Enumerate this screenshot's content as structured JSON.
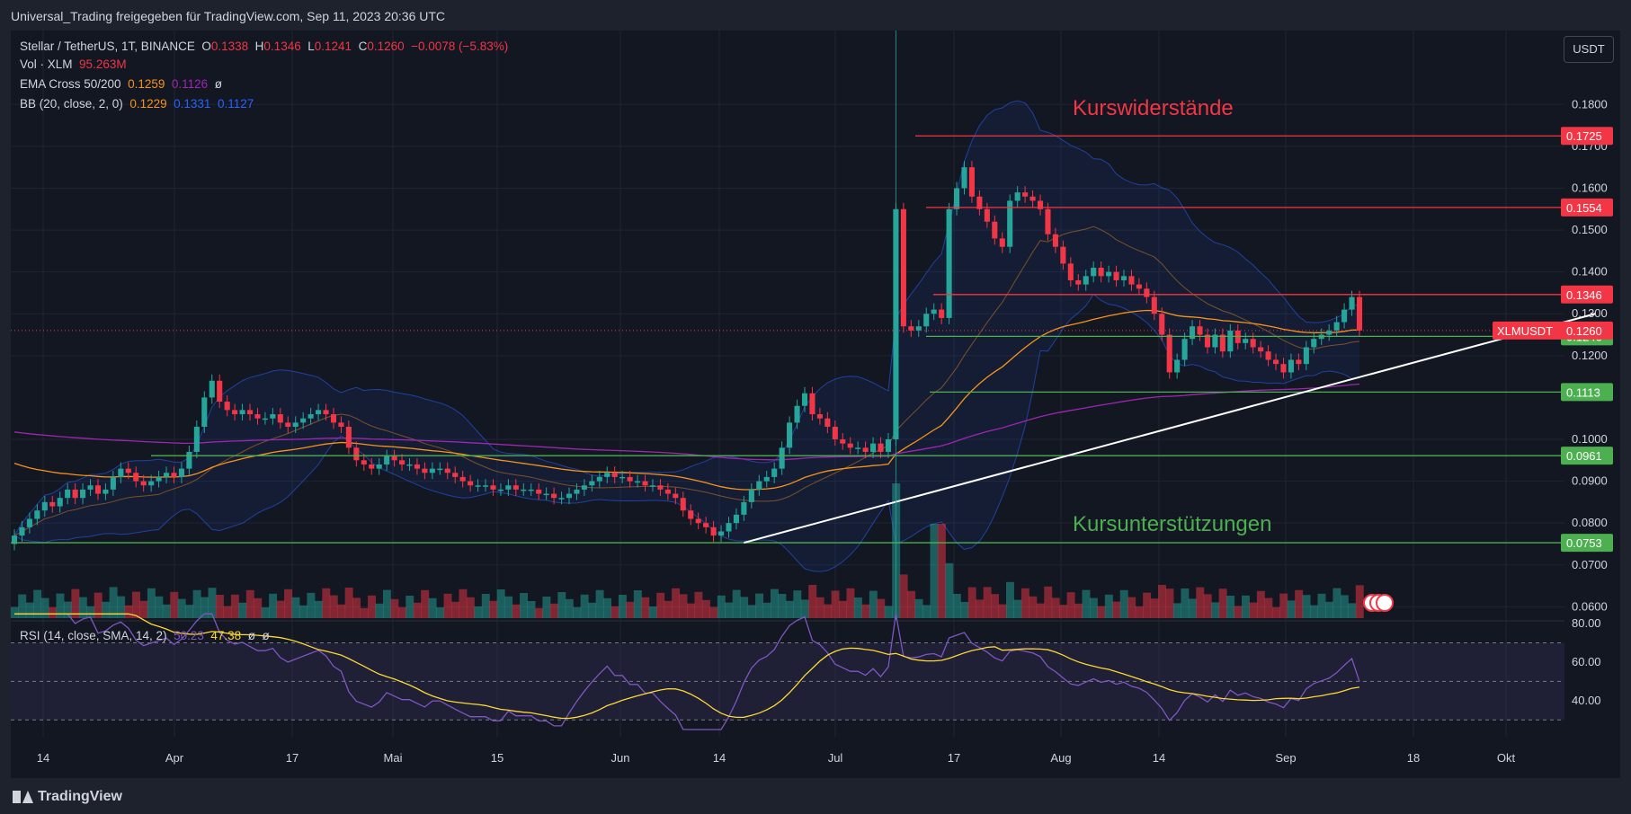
{
  "header": {
    "text": "Universal_Trading freigegeben für TradingView.com, Sep 11, 2023 20:36 UTC"
  },
  "footer": {
    "brand": "TradingView"
  },
  "currency_button": "USDT",
  "legend": {
    "symbol": "Stellar / TetherUS, 1T, BINANCE",
    "o_label": "O",
    "o": "0.1338",
    "h_label": "H",
    "h": "0.1346",
    "l_label": "L",
    "l": "0.1241",
    "c_label": "C",
    "c": "0.1260",
    "change": "−0.0078 (−5.83%)",
    "vol_label": "Vol · XLM",
    "vol": "95.263M",
    "ema_label": "EMA Cross 50/200",
    "ema50": "0.1259",
    "ema200": "0.1126",
    "ema_sym": "ø",
    "bb_label": "BB (20, close, 2, 0)",
    "bb_mid": "0.1229",
    "bb_up": "0.1331",
    "bb_low": "0.1127",
    "rsi_label": "RSI (14, close, SMA, 14, 2)",
    "rsi": "50.23",
    "rsi_ma": "47.38",
    "rsi_sym1": "ø",
    "rsi_sym2": "ø"
  },
  "annotations": {
    "resistance": "Kurswiderstände",
    "support": "Kursunterstützungen"
  },
  "colors": {
    "bg": "#131722",
    "up": "#26a69a",
    "down": "#f23645",
    "resistance": "#f23645",
    "support": "#4caf50",
    "ema50": "#f7931a",
    "ema200": "#9c27b0",
    "bb": "#2962ff",
    "rsi": "#7e57c2",
    "rsi_ma": "#fdd835",
    "trend": "#ffffff"
  },
  "chart_data": {
    "type": "candlestick",
    "y_ticks": [
      "0.1800",
      "0.1700",
      "0.1600",
      "0.1500",
      "0.1400",
      "0.1300",
      "0.1200",
      "0.1000",
      "0.0900",
      "0.0800",
      "0.0700",
      "0.0600"
    ],
    "x_ticks": [
      "14",
      "Apr",
      "17",
      "Mai",
      "15",
      "Jun",
      "14",
      "Jul",
      "17",
      "Aug",
      "14",
      "Sep",
      "18",
      "Okt"
    ],
    "ylim": [
      0.059,
      0.1835
    ],
    "rsi_ticks": [
      "80.00",
      "60.00",
      "40.00"
    ],
    "resistance_levels": [
      {
        "value": 0.1725,
        "label": "0.1725"
      },
      {
        "value": 0.1554,
        "label": "0.1554"
      },
      {
        "value": 0.1346,
        "label": "0.1346"
      }
    ],
    "support_levels": [
      {
        "value": 0.1246,
        "label": "0.1246"
      },
      {
        "value": 0.1113,
        "label": "0.1113"
      },
      {
        "value": 0.0961,
        "label": "0.0961"
      },
      {
        "value": 0.0753,
        "label": "0.0753"
      }
    ],
    "last_price": {
      "label": "XLMUSDT",
      "value": "0.1260"
    },
    "trendline": {
      "from": {
        "date": "2023-06-15",
        "price": 0.0753
      },
      "to": {
        "date": "2023-10-05",
        "price": 0.13
      }
    },
    "closes": [
      0.077,
      0.079,
      0.081,
      0.083,
      0.085,
      0.084,
      0.086,
      0.088,
      0.086,
      0.088,
      0.089,
      0.087,
      0.088,
      0.091,
      0.093,
      0.092,
      0.09,
      0.089,
      0.09,
      0.091,
      0.092,
      0.091,
      0.093,
      0.097,
      0.103,
      0.11,
      0.114,
      0.109,
      0.107,
      0.106,
      0.107,
      0.106,
      0.105,
      0.105,
      0.106,
      0.104,
      0.103,
      0.104,
      0.105,
      0.106,
      0.107,
      0.106,
      0.104,
      0.103,
      0.098,
      0.095,
      0.094,
      0.093,
      0.094,
      0.096,
      0.095,
      0.094,
      0.094,
      0.093,
      0.092,
      0.093,
      0.093,
      0.092,
      0.091,
      0.09,
      0.089,
      0.089,
      0.089,
      0.088,
      0.088,
      0.089,
      0.088,
      0.088,
      0.088,
      0.087,
      0.087,
      0.086,
      0.086,
      0.087,
      0.088,
      0.089,
      0.09,
      0.091,
      0.092,
      0.091,
      0.091,
      0.09,
      0.09,
      0.089,
      0.089,
      0.088,
      0.087,
      0.086,
      0.083,
      0.081,
      0.08,
      0.079,
      0.077,
      0.078,
      0.08,
      0.082,
      0.085,
      0.088,
      0.09,
      0.091,
      0.093,
      0.098,
      0.104,
      0.108,
      0.111,
      0.106,
      0.105,
      0.103,
      0.1,
      0.099,
      0.098,
      0.098,
      0.097,
      0.099,
      0.097,
      0.1,
      0.155,
      0.127,
      0.126,
      0.127,
      0.13,
      0.131,
      0.129,
      0.155,
      0.16,
      0.165,
      0.158,
      0.155,
      0.152,
      0.148,
      0.146,
      0.157,
      0.159,
      0.158,
      0.157,
      0.155,
      0.149,
      0.146,
      0.142,
      0.138,
      0.137,
      0.139,
      0.141,
      0.139,
      0.14,
      0.138,
      0.139,
      0.137,
      0.136,
      0.134,
      0.13,
      0.125,
      0.116,
      0.119,
      0.124,
      0.127,
      0.125,
      0.122,
      0.125,
      0.121,
      0.126,
      0.123,
      0.124,
      0.122,
      0.121,
      0.119,
      0.118,
      0.116,
      0.119,
      0.118,
      0.122,
      0.124,
      0.125,
      0.126,
      0.128,
      0.131,
      0.134,
      0.126
    ]
  }
}
